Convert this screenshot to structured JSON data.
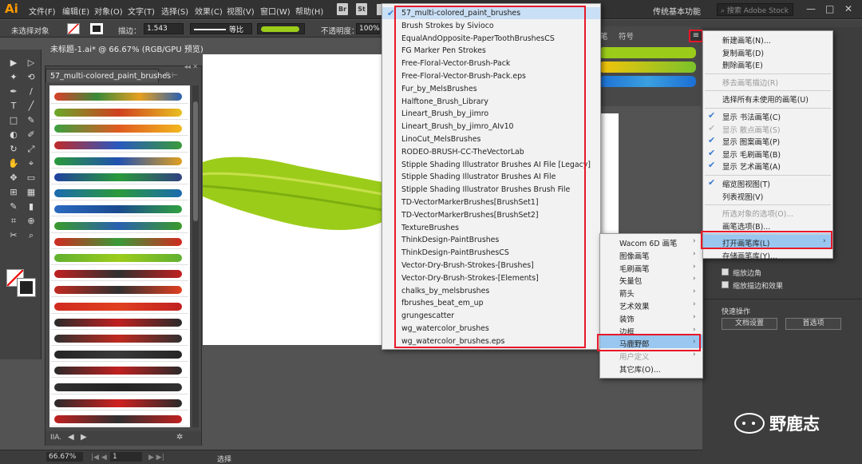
{
  "app": {
    "logo": "Ai",
    "workspace": "传统基本功能",
    "stock_search_placeholder": "搜索 Adobe Stock"
  },
  "menubar": [
    "文件(F)",
    "编辑(E)",
    "对象(O)",
    "文字(T)",
    "选择(S)",
    "效果(C)",
    "视图(V)",
    "窗口(W)",
    "帮助(H)"
  ],
  "app_buttons": [
    "Br",
    "St"
  ],
  "window_controls": [
    "—",
    "□",
    "✕"
  ],
  "control_bar": {
    "no_selection": "未选择对象",
    "stroke_label": "描边：",
    "stroke_value": "1.543",
    "profile": "等比",
    "opacity_label": "不透明度：",
    "opacity_value": "100%"
  },
  "document_tab": "未标题-1.ai* @ 66.67% (RGB/GPU 预览)",
  "library_panel": {
    "tab": "57_multi-colored_paint_brushes",
    "tab_extra": "F  ⊢",
    "brush_count": 21
  },
  "brushes_panel": {
    "tab_brushes": "笔",
    "tab_symbols": "符号",
    "menu_icon": "≡"
  },
  "library_menu": {
    "checked": "57_multi-colored_paint_brushes",
    "items": [
      "57_multi-colored_paint_brushes",
      "Brush Strokes by Sivioco",
      "EqualAndOpposite-PaperToothBrushesCS",
      "FG Marker Pen Strokes",
      "Free-Floral-Vector-Brush-Pack",
      "Free-Floral-Vector-Brush-Pack.eps",
      "Fur_by_MelsBrushes",
      "Halftone_Brush_Library",
      "Lineart_Brush_by_jimro",
      "Lineart_Brush_by_jimro_AIv10",
      "LinoCut_MelsBrushes",
      "RODEO-BRUSH-CC-TheVectorLab",
      "Stipple Shading Illustrator Brushes AI File [Legacy]",
      "Stipple Shading Illustrator Brushes AI File",
      "Stipple Shading Illustrator Brushes Brush File",
      "TD-VectorMarkerBrushes[BrushSet1]",
      "TD-VectorMarkerBrushes[BrushSet2]",
      "TextureBrushes",
      "ThinkDesign-PaintBrushes",
      "ThinkDesign-PaintBrushesCS",
      "Vector-Dry-Brush-Strokes-[Brushes]",
      "Vector-Dry-Brush-Strokes-[Elements]",
      "chalks_by_melsbrushes",
      "fbrushes_beat_em_up",
      "grungescatter",
      "wg_watercolor_brushes",
      "wg_watercolor_brushes.eps"
    ]
  },
  "submenu": {
    "items": [
      {
        "label": "Wacom 6D 画笔",
        "arrow": true
      },
      {
        "label": "图像画笔",
        "arrow": true
      },
      {
        "label": "毛刷画笔",
        "arrow": true
      },
      {
        "label": "矢量包",
        "arrow": true
      },
      {
        "label": "箭头",
        "arrow": true
      },
      {
        "label": "艺术效果",
        "arrow": true
      },
      {
        "label": "装饰",
        "arrow": true
      },
      {
        "label": "边框",
        "arrow": true
      },
      {
        "label": "马鹿野郎",
        "arrow": true,
        "highlighted": true
      },
      {
        "label": "用户定义",
        "arrow": true,
        "disabled": true
      },
      {
        "label": "其它库(O)...",
        "arrow": false
      }
    ]
  },
  "flyout": {
    "items": [
      {
        "label": "新建画笔(N)...",
        "check": false,
        "disabled": false
      },
      {
        "label": "复制画笔(D)",
        "check": false,
        "disabled": false
      },
      {
        "label": "删除画笔(E)",
        "check": false,
        "disabled": false
      },
      {
        "sep": true
      },
      {
        "label": "移去画笔描边(R)",
        "check": false,
        "disabled": true
      },
      {
        "sep": true
      },
      {
        "label": "选择所有未使用的画笔(U)",
        "check": false,
        "disabled": false
      },
      {
        "sep": true
      },
      {
        "label": "显示 书法画笔(C)",
        "check": true,
        "disabled": false
      },
      {
        "label": "显示 散点画笔(S)",
        "check": true,
        "disabled": true
      },
      {
        "label": "显示 图案画笔(P)",
        "check": true,
        "disabled": false
      },
      {
        "label": "显示 毛刷画笔(B)",
        "check": true,
        "disabled": false
      },
      {
        "label": "显示 艺术画笔(A)",
        "check": true,
        "disabled": false
      },
      {
        "sep": true
      },
      {
        "label": "缩览图视图(T)",
        "check": true,
        "disabled": false
      },
      {
        "label": "列表视图(V)",
        "check": false,
        "disabled": false
      },
      {
        "sep": true
      },
      {
        "label": "所选对象的选项(O)...",
        "check": false,
        "disabled": true
      },
      {
        "label": "画笔选项(B)...",
        "check": false,
        "disabled": false
      },
      {
        "sep": true
      },
      {
        "label": "打开画笔库(L)",
        "check": false,
        "disabled": false,
        "arrow": true,
        "highlighted": true
      },
      {
        "label": "存储画笔库(Y)...",
        "check": false,
        "disabled": false
      }
    ]
  },
  "properties": {
    "scale_corners": "缩放边角",
    "scale_strokes": "缩放描边和效果",
    "quick_actions": "快速操作",
    "doc_setup": "文档设置",
    "preferences": "首选项"
  },
  "status": {
    "zoom": "66.67%",
    "page": "1",
    "tool": "选择"
  },
  "watermark": "野鹿志",
  "colors": {
    "highlight_box": "#e8182a",
    "menu_hover": "#99c7f0",
    "brush_green": "#9ccc1a"
  }
}
